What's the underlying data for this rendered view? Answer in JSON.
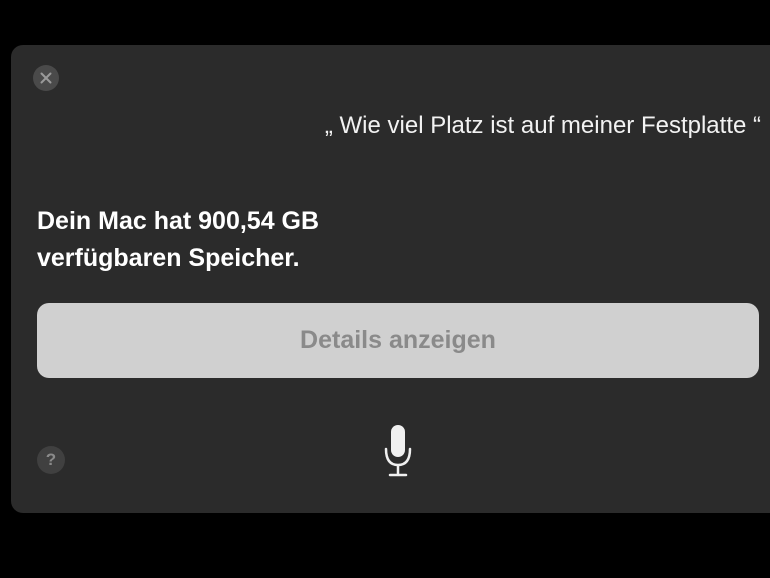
{
  "dialog": {
    "query_text": "„ Wie viel Platz ist auf meiner Festplatte “",
    "answer_text": "Dein Mac hat 900,54 GB verfügbaren Speicher.",
    "details_button_label": "Details anzeigen",
    "help_label": "?"
  },
  "icons": {
    "close": "close-icon",
    "help": "help-icon",
    "microphone": "microphone-icon"
  },
  "colors": {
    "panel_background": "#2b2b2b",
    "button_background": "#d0d0d0",
    "button_text": "#8a8a8a",
    "text_primary": "#ffffff"
  }
}
